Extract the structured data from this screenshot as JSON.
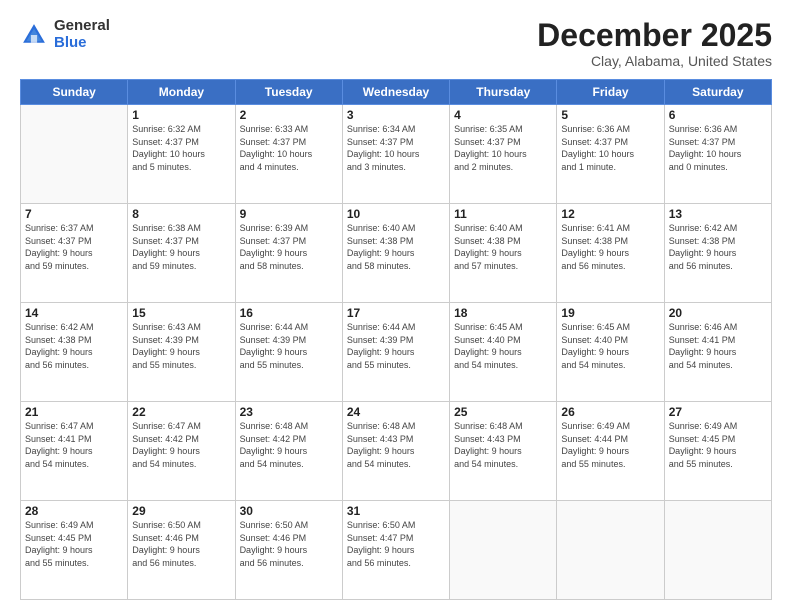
{
  "logo": {
    "general": "General",
    "blue": "Blue"
  },
  "header": {
    "month": "December 2025",
    "location": "Clay, Alabama, United States"
  },
  "weekdays": [
    "Sunday",
    "Monday",
    "Tuesday",
    "Wednesday",
    "Thursday",
    "Friday",
    "Saturday"
  ],
  "weeks": [
    [
      {
        "day": "",
        "info": ""
      },
      {
        "day": "1",
        "info": "Sunrise: 6:32 AM\nSunset: 4:37 PM\nDaylight: 10 hours\nand 5 minutes."
      },
      {
        "day": "2",
        "info": "Sunrise: 6:33 AM\nSunset: 4:37 PM\nDaylight: 10 hours\nand 4 minutes."
      },
      {
        "day": "3",
        "info": "Sunrise: 6:34 AM\nSunset: 4:37 PM\nDaylight: 10 hours\nand 3 minutes."
      },
      {
        "day": "4",
        "info": "Sunrise: 6:35 AM\nSunset: 4:37 PM\nDaylight: 10 hours\nand 2 minutes."
      },
      {
        "day": "5",
        "info": "Sunrise: 6:36 AM\nSunset: 4:37 PM\nDaylight: 10 hours\nand 1 minute."
      },
      {
        "day": "6",
        "info": "Sunrise: 6:36 AM\nSunset: 4:37 PM\nDaylight: 10 hours\nand 0 minutes."
      }
    ],
    [
      {
        "day": "7",
        "info": "Sunrise: 6:37 AM\nSunset: 4:37 PM\nDaylight: 9 hours\nand 59 minutes."
      },
      {
        "day": "8",
        "info": "Sunrise: 6:38 AM\nSunset: 4:37 PM\nDaylight: 9 hours\nand 59 minutes."
      },
      {
        "day": "9",
        "info": "Sunrise: 6:39 AM\nSunset: 4:37 PM\nDaylight: 9 hours\nand 58 minutes."
      },
      {
        "day": "10",
        "info": "Sunrise: 6:40 AM\nSunset: 4:38 PM\nDaylight: 9 hours\nand 58 minutes."
      },
      {
        "day": "11",
        "info": "Sunrise: 6:40 AM\nSunset: 4:38 PM\nDaylight: 9 hours\nand 57 minutes."
      },
      {
        "day": "12",
        "info": "Sunrise: 6:41 AM\nSunset: 4:38 PM\nDaylight: 9 hours\nand 56 minutes."
      },
      {
        "day": "13",
        "info": "Sunrise: 6:42 AM\nSunset: 4:38 PM\nDaylight: 9 hours\nand 56 minutes."
      }
    ],
    [
      {
        "day": "14",
        "info": "Sunrise: 6:42 AM\nSunset: 4:38 PM\nDaylight: 9 hours\nand 56 minutes."
      },
      {
        "day": "15",
        "info": "Sunrise: 6:43 AM\nSunset: 4:39 PM\nDaylight: 9 hours\nand 55 minutes."
      },
      {
        "day": "16",
        "info": "Sunrise: 6:44 AM\nSunset: 4:39 PM\nDaylight: 9 hours\nand 55 minutes."
      },
      {
        "day": "17",
        "info": "Sunrise: 6:44 AM\nSunset: 4:39 PM\nDaylight: 9 hours\nand 55 minutes."
      },
      {
        "day": "18",
        "info": "Sunrise: 6:45 AM\nSunset: 4:40 PM\nDaylight: 9 hours\nand 54 minutes."
      },
      {
        "day": "19",
        "info": "Sunrise: 6:45 AM\nSunset: 4:40 PM\nDaylight: 9 hours\nand 54 minutes."
      },
      {
        "day": "20",
        "info": "Sunrise: 6:46 AM\nSunset: 4:41 PM\nDaylight: 9 hours\nand 54 minutes."
      }
    ],
    [
      {
        "day": "21",
        "info": "Sunrise: 6:47 AM\nSunset: 4:41 PM\nDaylight: 9 hours\nand 54 minutes."
      },
      {
        "day": "22",
        "info": "Sunrise: 6:47 AM\nSunset: 4:42 PM\nDaylight: 9 hours\nand 54 minutes."
      },
      {
        "day": "23",
        "info": "Sunrise: 6:48 AM\nSunset: 4:42 PM\nDaylight: 9 hours\nand 54 minutes."
      },
      {
        "day": "24",
        "info": "Sunrise: 6:48 AM\nSunset: 4:43 PM\nDaylight: 9 hours\nand 54 minutes."
      },
      {
        "day": "25",
        "info": "Sunrise: 6:48 AM\nSunset: 4:43 PM\nDaylight: 9 hours\nand 54 minutes."
      },
      {
        "day": "26",
        "info": "Sunrise: 6:49 AM\nSunset: 4:44 PM\nDaylight: 9 hours\nand 55 minutes."
      },
      {
        "day": "27",
        "info": "Sunrise: 6:49 AM\nSunset: 4:45 PM\nDaylight: 9 hours\nand 55 minutes."
      }
    ],
    [
      {
        "day": "28",
        "info": "Sunrise: 6:49 AM\nSunset: 4:45 PM\nDaylight: 9 hours\nand 55 minutes."
      },
      {
        "day": "29",
        "info": "Sunrise: 6:50 AM\nSunset: 4:46 PM\nDaylight: 9 hours\nand 56 minutes."
      },
      {
        "day": "30",
        "info": "Sunrise: 6:50 AM\nSunset: 4:46 PM\nDaylight: 9 hours\nand 56 minutes."
      },
      {
        "day": "31",
        "info": "Sunrise: 6:50 AM\nSunset: 4:47 PM\nDaylight: 9 hours\nand 56 minutes."
      },
      {
        "day": "",
        "info": ""
      },
      {
        "day": "",
        "info": ""
      },
      {
        "day": "",
        "info": ""
      }
    ]
  ]
}
